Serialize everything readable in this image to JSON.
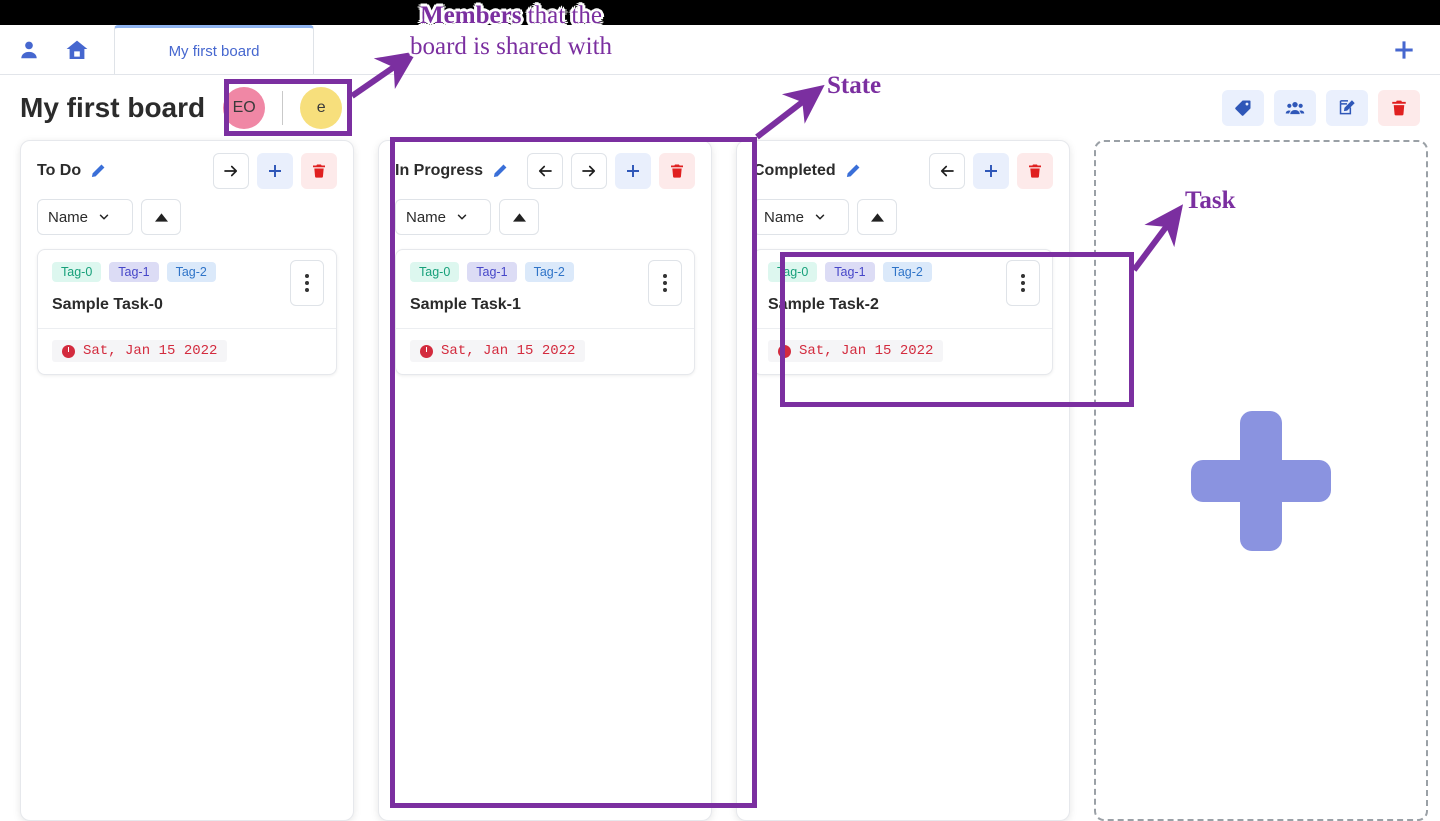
{
  "navbar": {
    "profile_icon": "person-icon",
    "home_icon": "home-icon",
    "add_icon": "plus-icon",
    "tabs": [
      {
        "label": "My first board",
        "active": true
      }
    ]
  },
  "header": {
    "board_title": "My first board",
    "members": [
      {
        "initials": "EO",
        "color": "#f087a5"
      },
      {
        "initials": "e",
        "color": "#f7df7c"
      }
    ],
    "tools": [
      {
        "name": "tag-icon",
        "label": "Tags"
      },
      {
        "name": "members-icon",
        "label": "Members"
      },
      {
        "name": "edit-square-icon",
        "label": "Edit board"
      },
      {
        "name": "trash-icon",
        "label": "Delete board"
      }
    ]
  },
  "columns": [
    {
      "title": "To Do",
      "edit_icon": "pencil-icon",
      "actions": [
        "move-right",
        "add-task",
        "delete-state"
      ],
      "sort": {
        "field": "Name",
        "direction": "asc",
        "direction_icon": "caret-up-icon"
      },
      "tasks": [
        {
          "name": "Sample Task-0",
          "tags": [
            "Tag-0",
            "Tag-1",
            "Tag-2"
          ],
          "due_date": "Sat, Jan 15 2022",
          "due_icon": "clock-icon",
          "menu_icon": "kebab-menu-icon"
        }
      ]
    },
    {
      "title": "In Progress",
      "edit_icon": "pencil-icon",
      "actions": [
        "move-left",
        "move-right",
        "add-task",
        "delete-state"
      ],
      "sort": {
        "field": "Name",
        "direction": "asc",
        "direction_icon": "caret-up-icon"
      },
      "tasks": [
        {
          "name": "Sample Task-1",
          "tags": [
            "Tag-0",
            "Tag-1",
            "Tag-2"
          ],
          "due_date": "Sat, Jan 15 2022",
          "due_icon": "clock-icon",
          "menu_icon": "kebab-menu-icon"
        }
      ]
    },
    {
      "title": "Completed",
      "edit_icon": "pencil-icon",
      "actions": [
        "move-left",
        "add-task",
        "delete-state"
      ],
      "sort": {
        "field": "Name",
        "direction": "asc",
        "direction_icon": "caret-up-icon"
      },
      "tasks": [
        {
          "name": "Sample Task-2",
          "tags": [
            "Tag-0",
            "Tag-1",
            "Tag-2"
          ],
          "due_date": "Sat, Jan 15 2022",
          "due_icon": "clock-icon",
          "menu_icon": "kebab-menu-icon"
        }
      ]
    }
  ],
  "add_column": {
    "icon": "big-plus-icon",
    "label": "Add state"
  },
  "annotations": [
    {
      "id": "members",
      "bold": "Members",
      "rest": " that the",
      "line2": "board is shared with"
    },
    {
      "id": "state",
      "bold": "State",
      "rest": "",
      "line2": ""
    },
    {
      "id": "task",
      "bold": "Task",
      "rest": "",
      "line2": ""
    }
  ],
  "colors": {
    "accent_blue": "#4667cf",
    "danger_red": "#e02020",
    "annotation_purple": "#7b2fa0",
    "tag_0_bg": "#ddf7ef",
    "tag_0_fg": "#17a07a",
    "tag_1_bg": "#dcdcf5",
    "tag_1_fg": "#4646c8",
    "tag_2_bg": "#dbe9fa",
    "tag_2_fg": "#2f74c8",
    "due_red": "#d32b3e",
    "big_plus": "#8a93e0"
  }
}
